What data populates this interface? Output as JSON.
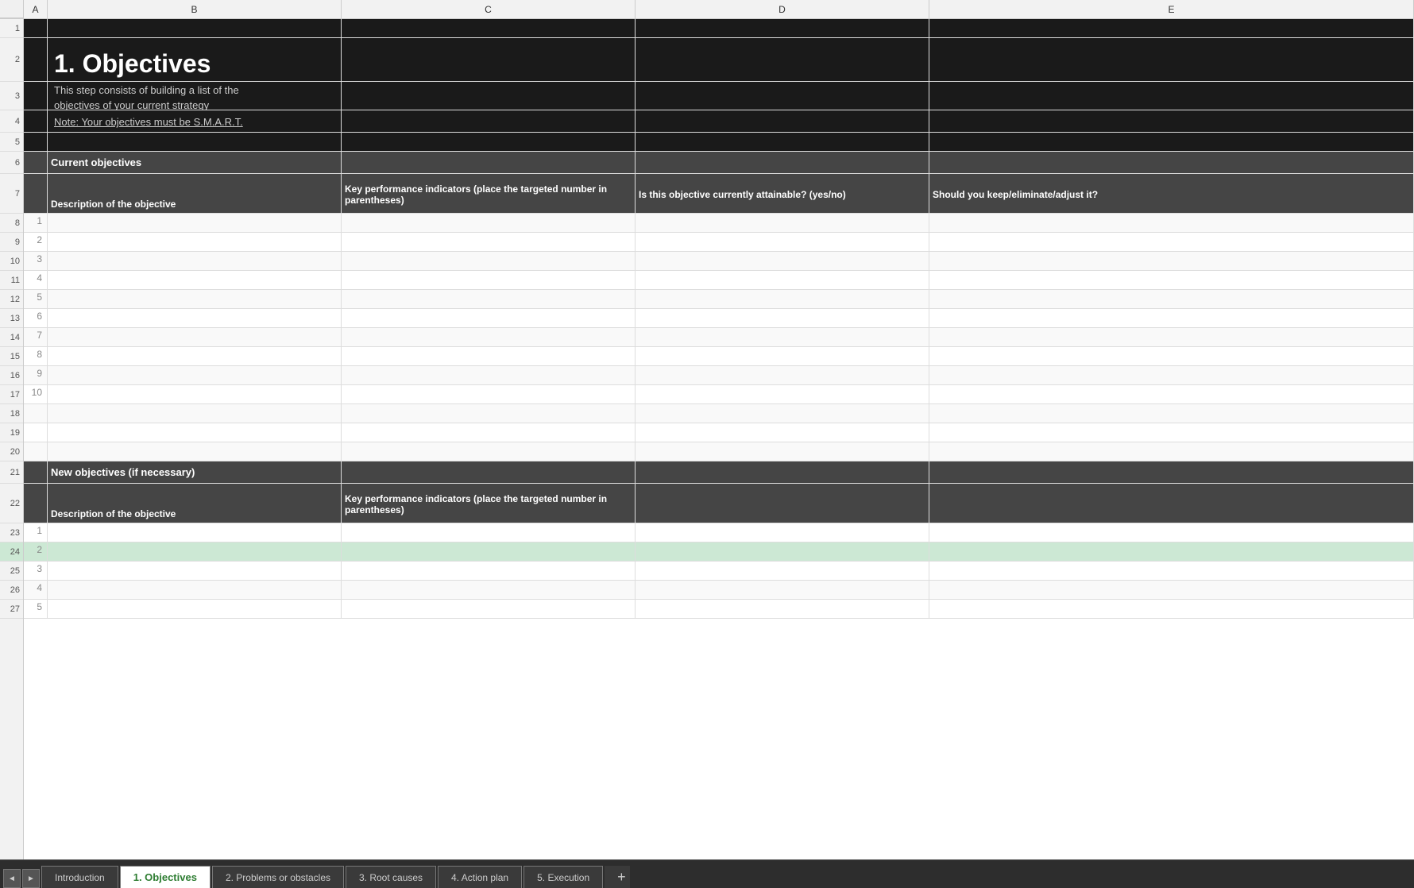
{
  "columns": {
    "headers": [
      "",
      "A",
      "B",
      "C",
      "D",
      "E"
    ],
    "widths": [
      30,
      30,
      370,
      370,
      370,
      370
    ]
  },
  "title": {
    "main": "1. Objectives",
    "description_line1": "This step consists of building a list of the",
    "description_line2": "objectives of your current strategy",
    "note": "Note: Your objectives must be S.M.A.R.T."
  },
  "current_objectives": {
    "section_label": "Current objectives",
    "col_b_label": "Description of the objective",
    "col_c_label": "Key performance indicators (place the targeted number in parentheses)",
    "col_d_label": "Is this objective currently attainable? (yes/no)",
    "col_e_label": "Should you keep/eliminate/adjust it?",
    "rows": [
      1,
      2,
      3,
      4,
      5,
      6,
      7,
      8,
      9,
      10
    ]
  },
  "new_objectives": {
    "section_label": "New objectives (if necessary)",
    "col_b_label": "Description of the objective",
    "col_c_label": "Key performance indicators (place the targeted number in parentheses)",
    "rows": [
      1,
      2,
      3,
      4,
      5
    ]
  },
  "row_numbers": [
    1,
    2,
    3,
    4,
    5,
    6,
    7,
    8,
    9,
    10,
    11,
    12,
    13,
    14,
    15,
    16,
    17,
    18,
    19,
    20,
    21,
    22,
    23,
    24,
    25,
    26,
    27
  ],
  "tabs": {
    "nav_prev": "◄",
    "nav_next": "►",
    "items": [
      {
        "label": "Introduction",
        "active": false
      },
      {
        "label": "1. Objectives",
        "active": true
      },
      {
        "label": "2. Problems or obstacles",
        "active": false
      },
      {
        "label": "3. Root causes",
        "active": false
      },
      {
        "label": "4. Action plan",
        "active": false
      },
      {
        "label": "5. Execution",
        "active": false
      }
    ],
    "add_label": "+"
  }
}
